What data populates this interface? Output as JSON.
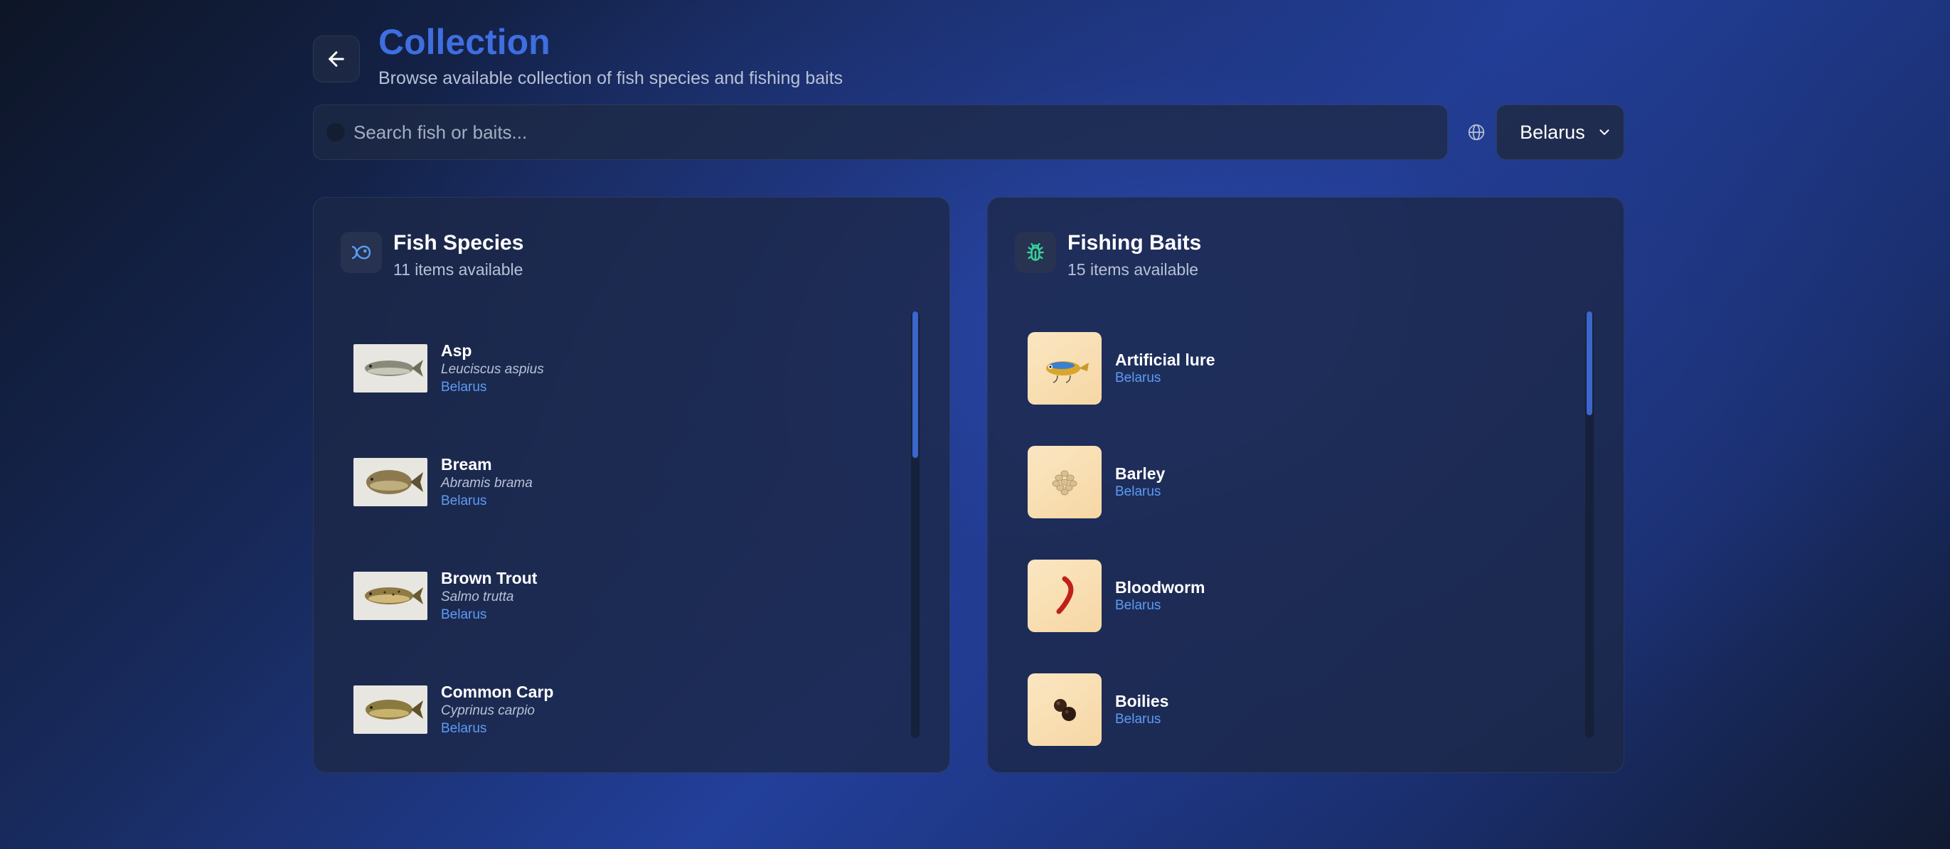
{
  "header": {
    "title": "Collection",
    "subtitle": "Browse available collection of fish species and fishing baits"
  },
  "search": {
    "placeholder": "Search fish or baits..."
  },
  "region": {
    "selected": "Belarus"
  },
  "fish_panel": {
    "title": "Fish Species",
    "count_text": "11 items available",
    "items": [
      {
        "name": "Asp",
        "scientific": "Leuciscus aspius",
        "region": "Belarus"
      },
      {
        "name": "Bream",
        "scientific": "Abramis brama",
        "region": "Belarus"
      },
      {
        "name": "Brown Trout",
        "scientific": "Salmo trutta",
        "region": "Belarus"
      },
      {
        "name": "Common Carp",
        "scientific": "Cyprinus carpio",
        "region": "Belarus"
      }
    ]
  },
  "bait_panel": {
    "title": "Fishing Baits",
    "count_text": "15 items available",
    "items": [
      {
        "name": "Artificial lure",
        "region": "Belarus",
        "icon": "lure-icon"
      },
      {
        "name": "Barley",
        "region": "Belarus",
        "icon": "barley-icon"
      },
      {
        "name": "Bloodworm",
        "region": "Belarus",
        "icon": "bloodworm-icon"
      },
      {
        "name": "Boilies",
        "region": "Belarus",
        "icon": "boilies-icon"
      }
    ]
  },
  "colors": {
    "accent": "#3f6ee0",
    "region_link": "#5c9cf5",
    "bait_icon": "#34d399"
  }
}
